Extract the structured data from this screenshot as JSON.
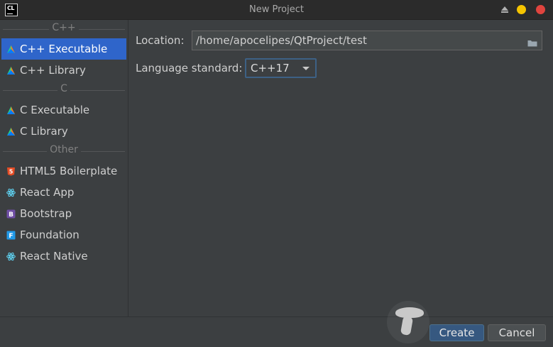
{
  "window": {
    "title": "New Project",
    "app_icon_text": "CL"
  },
  "sidebar": {
    "groups": [
      {
        "label": "C++",
        "items": [
          {
            "label": "C++ Executable",
            "icon": "clion-triangle-icon",
            "selected": true
          },
          {
            "label": "C++ Library",
            "icon": "clion-triangle-icon"
          }
        ]
      },
      {
        "label": "C",
        "items": [
          {
            "label": "C Executable",
            "icon": "clion-triangle-icon"
          },
          {
            "label": "C Library",
            "icon": "clion-triangle-icon"
          }
        ]
      },
      {
        "label": "Other",
        "items": [
          {
            "label": "HTML5 Boilerplate",
            "icon": "html5-icon"
          },
          {
            "label": "React App",
            "icon": "react-icon"
          },
          {
            "label": "Bootstrap",
            "icon": "bootstrap-icon"
          },
          {
            "label": "Foundation",
            "icon": "foundation-icon"
          },
          {
            "label": "React Native",
            "icon": "react-icon"
          }
        ]
      }
    ]
  },
  "form": {
    "location_label": "Location:",
    "location_value": "/home/apocelipes/QtProject/test",
    "language_label": "Language standard:",
    "language_value": "C++17"
  },
  "buttons": {
    "create": "Create",
    "cancel": "Cancel"
  },
  "colors": {
    "selection": "#2f65ca",
    "background": "#3c3f41",
    "close": "#e0443e",
    "minimize": "#f5c400"
  }
}
